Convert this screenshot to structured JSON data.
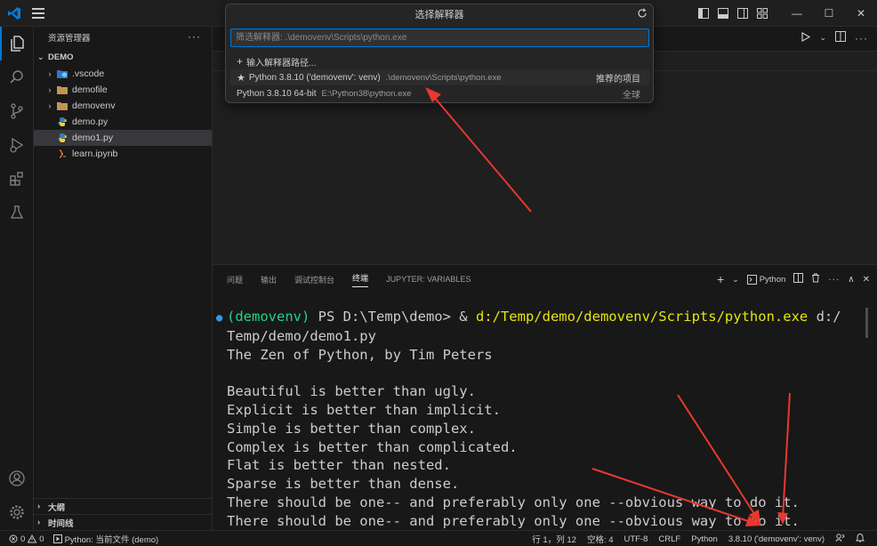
{
  "colors": {
    "accent": "#0078d4",
    "terminal_venv": "#23d18b",
    "terminal_command": "#e5e510",
    "annotation_arrow": "#e8382f"
  },
  "titlebar": {
    "icons": [
      "vscode-logo-icon",
      "menu-icon",
      "toggle-primary-sidebar-icon",
      "toggle-panel-icon",
      "toggle-secondary-sidebar-icon",
      "customize-layout-icon"
    ],
    "window_controls": [
      "minimize",
      "maximize",
      "close"
    ],
    "minimize_glyph": "—",
    "maximize_glyph": "☐",
    "close_glyph": "✕"
  },
  "activitybar": {
    "icons": [
      "explorer-icon",
      "search-icon",
      "source-control-icon",
      "run-debug-icon",
      "extensions-icon",
      "testing-icon",
      "accounts-icon",
      "manage-gear-icon"
    ]
  },
  "sidebar": {
    "title": "资源管理器",
    "more": "···",
    "section": "DEMO",
    "items": [
      {
        "label": ".vscode",
        "type": "folder-vscode",
        "expandable": true
      },
      {
        "label": "demofile",
        "type": "folder",
        "expandable": true
      },
      {
        "label": "demovenv",
        "type": "folder",
        "expandable": true
      },
      {
        "label": "demo.py",
        "type": "python",
        "expandable": false
      },
      {
        "label": "demo1.py",
        "type": "python",
        "expandable": false,
        "selected": true
      },
      {
        "label": "learn.ipynb",
        "type": "notebook",
        "expandable": false
      }
    ],
    "outline": "大纲",
    "timeline": "时间线"
  },
  "quickpick": {
    "title": "选择解释器",
    "placeholder": "筛选解释器: .\\demovenv\\Scripts\\python.exe",
    "items": [
      {
        "icon": "+",
        "label": "输入解释器路径...",
        "desc": "",
        "tag": ""
      },
      {
        "icon": "★",
        "label": "Python 3.8.10 ('demovenv': venv)",
        "desc": ".\\demovenv\\Scripts\\python.exe",
        "tag": "推荐的项目"
      },
      {
        "icon": "",
        "label": "Python 3.8.10 64-bit",
        "desc": "E:\\Python38\\python.exe",
        "tag": "全球"
      }
    ]
  },
  "panel": {
    "tabs": [
      "问题",
      "输出",
      "调试控制台",
      "终端",
      "JUPYTER: VARIABLES"
    ],
    "active_tab": "终端",
    "terminal_name": "Python",
    "plus": "+",
    "chevron": "⌄",
    "up": "∧",
    "close": "✕"
  },
  "terminal": {
    "prompt_dot": "●",
    "venv": "(demovenv)",
    "prompt": " PS D:\\Temp\\demo> & ",
    "command": "d:/Temp/demo/demovenv/Scripts/python.exe",
    "arg_line1": " d:/",
    "arg_line2": "Temp/demo/demo1.py",
    "output": [
      "The Zen of Python, by Tim Peters",
      "",
      "Beautiful is better than ugly.",
      "Explicit is better than implicit.",
      "Simple is better than complex.",
      "Complex is better than complicated.",
      "Flat is better than nested.",
      "Sparse is better than dense.",
      "There should be one-- and preferably only one --obvious way to do it.",
      "There should be one-- and preferably only one --obvious way to do it."
    ]
  },
  "statusbar": {
    "errors": "0",
    "warnings": "0",
    "python_file": "Python: 当前文件 (demo)",
    "position": "行 1，列 12",
    "spaces": "空格: 4",
    "encoding": "UTF-8",
    "eol": "CRLF",
    "language": "Python",
    "interpreter": "3.8.10 ('demovenv': venv)"
  }
}
